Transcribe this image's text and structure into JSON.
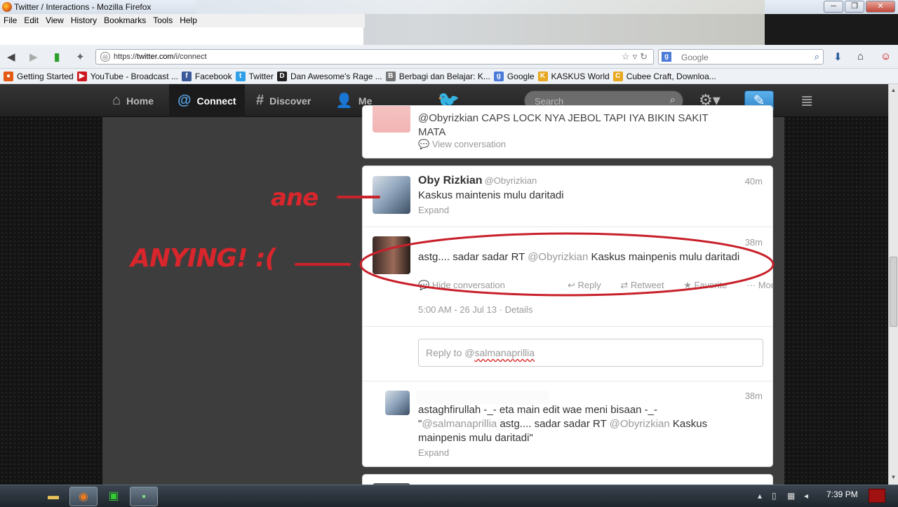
{
  "window": {
    "title": "Twitter / Interactions - Mozilla Firefox",
    "buttons": [
      "─",
      "❐",
      "✕"
    ]
  },
  "menu": [
    "File",
    "Edit",
    "View",
    "History",
    "Bookmarks",
    "Tools",
    "Help"
  ],
  "urlbar": {
    "url_prefix": "https://",
    "host": "twitter.com",
    "path": "/i/connect"
  },
  "search": {
    "placeholder": "Google"
  },
  "bookmarks": [
    {
      "label": "Getting Started",
      "color": "#e55b13",
      "glyph": "●"
    },
    {
      "label": "YouTube - Broadcast ...",
      "color": "#cc181e",
      "glyph": "▶"
    },
    {
      "label": "Facebook",
      "color": "#3b5998",
      "glyph": "f"
    },
    {
      "label": "Twitter",
      "color": "#2fa0e8",
      "glyph": "t"
    },
    {
      "label": "Dan Awesome's Rage ...",
      "color": "#222222",
      "glyph": "D"
    },
    {
      "label": "Berbagi dan Belajar: K...",
      "color": "#777777",
      "glyph": "B"
    },
    {
      "label": "Google",
      "color": "#4a7bd8",
      "glyph": "g"
    },
    {
      "label": "KASKUS World",
      "color": "#e8a820",
      "glyph": "K"
    },
    {
      "label": "Cubee Craft, Downloa...",
      "color": "#e8a820",
      "glyph": "C"
    }
  ],
  "twitter_nav": {
    "home": "Home",
    "connect": "Connect",
    "discover": "Discover",
    "me": "Me",
    "search_placeholder": "Search"
  },
  "tweets": {
    "top_partial": {
      "text_line1": "@Obyrizkian CAPS LOCK NYA JEBOL TAPI IYA BIKIN SAKIT",
      "text_line2": "MATA",
      "link": "View conversation"
    },
    "oby": {
      "name": "Oby Rizkian",
      "handle": "@Obyrizkian",
      "time": "40m",
      "text": "Kaskus maintenis mulu daritadi",
      "link": "Expand"
    },
    "salman": {
      "time": "38m",
      "text_pre": "astg.... sadar sadar RT ",
      "mention": "@Obyrizkian",
      "text_post": " Kaskus mainpenis mulu daritadi",
      "link": "Hide conversation",
      "reply": "Reply",
      "retweet": "Retweet",
      "favorite": "Favorite",
      "more": "More",
      "timestamp": "5:00 AM - 26 Jul 13",
      "details": "Details",
      "reply_placeholder_pre": "Reply to @",
      "reply_placeholder_handle": "salmanaprillia"
    },
    "reply_tweet": {
      "time": "38m",
      "line1": "astaghfirullah -_- eta main edit wae meni bisaan -_-",
      "q_open": "\"",
      "mention1": "@salmanaprillia",
      "mid": " astg.... sadar sadar RT ",
      "mention2": "@Obyrizkian",
      "line2_end": " Kaskus",
      "line3": "mainpenis mulu daritadi\"",
      "link": "Expand"
    }
  },
  "annotations": {
    "ane": "ane",
    "anying": "ANYING! :("
  },
  "taskbar": {
    "clock": "7:39 PM"
  }
}
